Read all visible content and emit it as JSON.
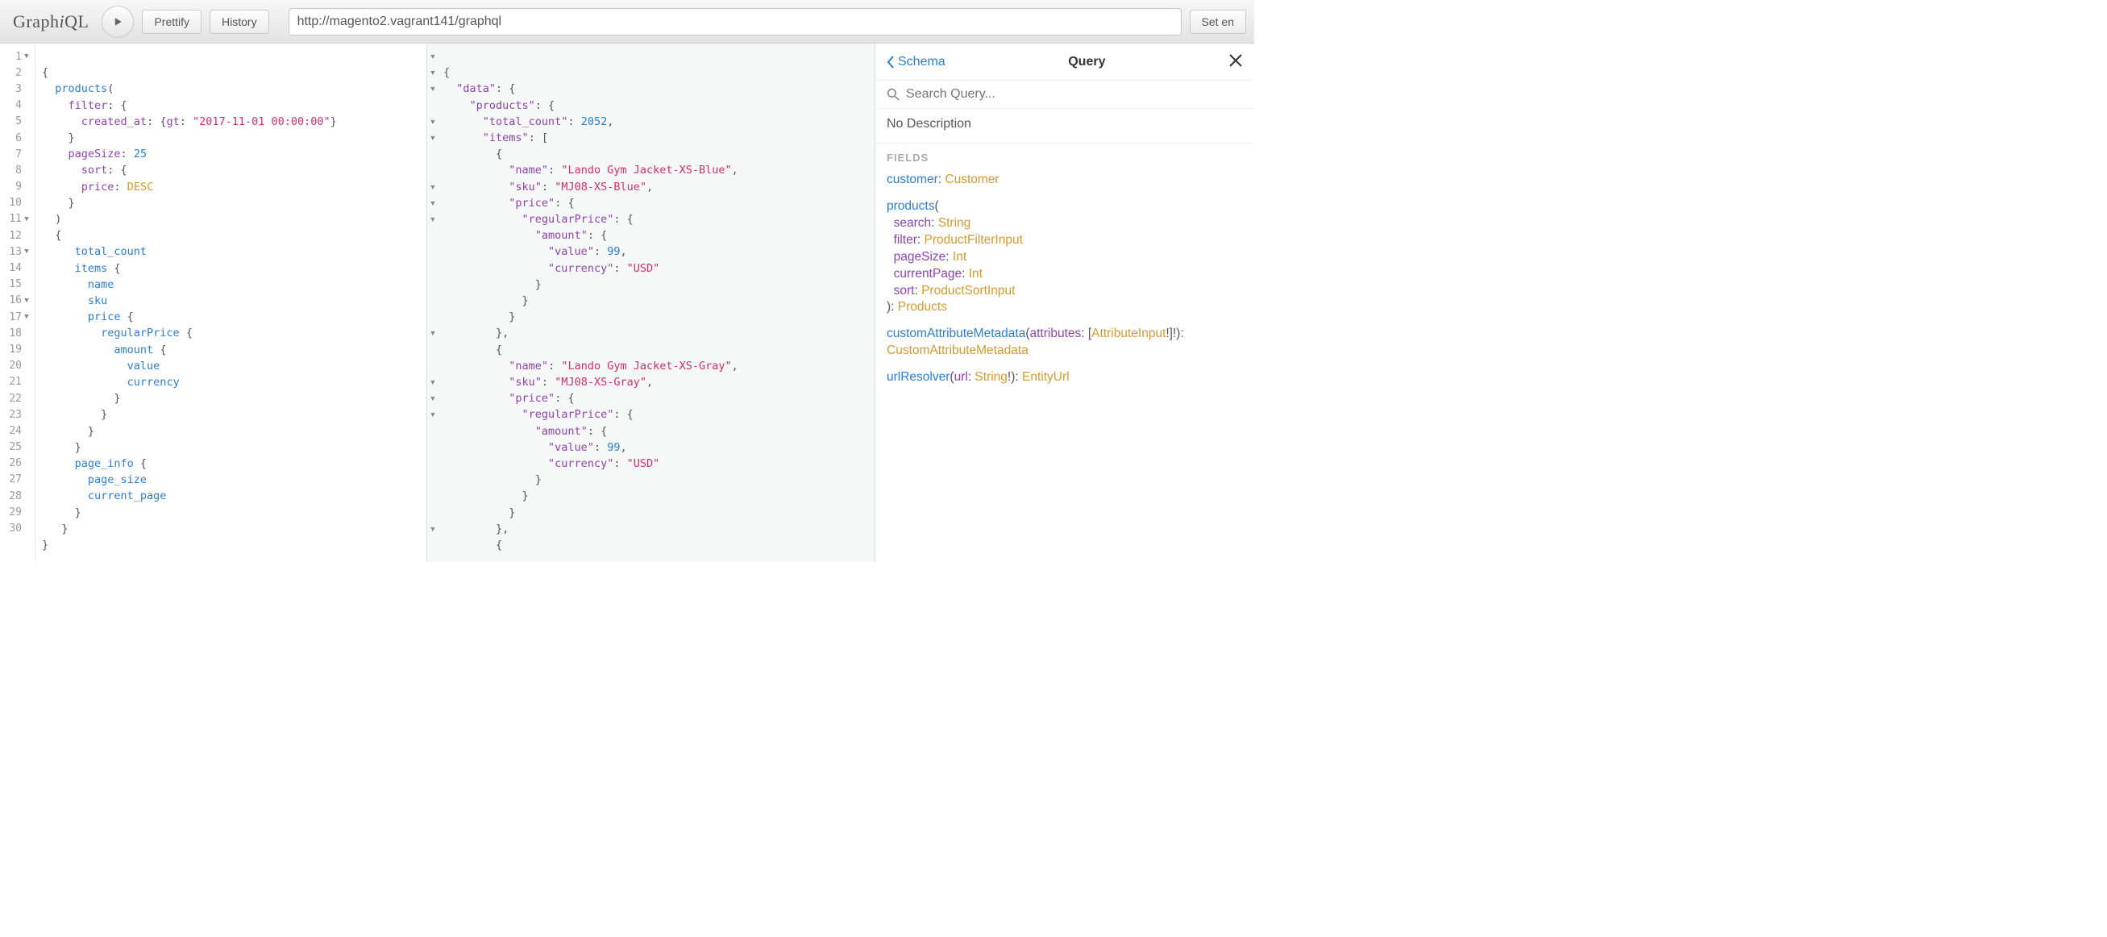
{
  "toolbar": {
    "logo_pre": "Graph",
    "logo_i": "i",
    "logo_post": "QL",
    "prettify": "Prettify",
    "history": "History",
    "endpoint": "http://magento2.vagrant141/graphql",
    "set_endpoint": "Set en"
  },
  "query_editor": {
    "line_numbers": [
      "1",
      "2",
      "3",
      "4",
      "5",
      "6",
      "7",
      "8",
      "9",
      "10",
      "11",
      "12",
      "13",
      "14",
      "15",
      "16",
      "17",
      "18",
      "19",
      "20",
      "21",
      "22",
      "23",
      "24",
      "25",
      "26",
      "27",
      "28",
      "29",
      "30"
    ],
    "fold_lines": [
      1,
      11,
      13,
      16,
      17
    ],
    "tokens": {
      "l1": "{",
      "l2_field": "products",
      "l2_paren": "(",
      "l3_attr": "filter",
      "l3_rest": ": {",
      "l4_attr": "created_at",
      "l4_mid": ": {",
      "l4_attr2": "gt",
      "l4_colon": ": ",
      "l4_str": "\"2017-11-01 00:00:00\"",
      "l4_close": "}",
      "l5": "}",
      "l6_attr": "pageSize",
      "l6_colon": ": ",
      "l6_num": "25",
      "l7_attr": "sort",
      "l7_rest": ": {",
      "l8_attr": "price",
      "l8_colon": ": ",
      "l8_val": "DESC",
      "l9": "}",
      "l10": ")",
      "l11": "{",
      "l12": "total_count",
      "l13_field": "items",
      "l13_b": " {",
      "l14": "name",
      "l15": "sku",
      "l16_field": "price",
      "l16_b": " {",
      "l17_field": "regularPrice",
      "l17_b": " {",
      "l18_field": "amount",
      "l18_b": " {",
      "l19": "value",
      "l20": "currency",
      "l21": "}",
      "l22": "}",
      "l23": "}",
      "l24": "}",
      "l25_field": "page_info",
      "l25_b": " {",
      "l26": "page_size",
      "l27": "current_page",
      "l28": "}",
      "l29": "}",
      "l30": "}"
    }
  },
  "result": {
    "data_key": "\"data\"",
    "products_key": "\"products\"",
    "total_count_key": "\"total_count\"",
    "total_count_val": "2052",
    "items_key": "\"items\"",
    "open_brace": "{",
    "open_bracket": "[",
    "close_brace": "}",
    "close_brace_comma": "},",
    "colon_sp": ": ",
    "comma": ",",
    "name_key": "\"name\"",
    "sku_key": "\"sku\"",
    "price_key": "\"price\"",
    "regularPrice_key": "\"regularPrice\"",
    "amount_key": "\"amount\"",
    "value_key": "\"value\"",
    "currency_key": "\"currency\"",
    "value_num": "99",
    "currency_str": "\"USD\"",
    "item1_name": "\"Lando Gym Jacket-XS-Blue\"",
    "item1_sku": "\"MJ08-XS-Blue\"",
    "item2_name": "\"Lando Gym Jacket-XS-Gray\"",
    "item2_sku": "\"MJ08-XS-Gray\""
  },
  "doc": {
    "back_label": "Schema",
    "title": "Query",
    "search_placeholder": "Search Query...",
    "description": "No Description",
    "fields_label": "FIELDS",
    "fields": {
      "customer_name": "customer",
      "customer_type": "Customer",
      "products_name": "products",
      "products_args": {
        "search": {
          "name": "search",
          "type": "String"
        },
        "filter": {
          "name": "filter",
          "type": "ProductFilterInput"
        },
        "pageSize": {
          "name": "pageSize",
          "type": "Int"
        },
        "currentPage": {
          "name": "currentPage",
          "type": "Int"
        },
        "sort": {
          "name": "sort",
          "type": "ProductSortInput"
        }
      },
      "products_type": "Products",
      "cam_name": "customAttributeMetadata",
      "cam_arg_name": "attributes",
      "cam_arg_type": "AttributeInput",
      "cam_type": "CustomAttributeMetadata",
      "url_name": "urlResolver",
      "url_arg_name": "url",
      "url_arg_type": "String",
      "url_type": "EntityUrl"
    }
  }
}
